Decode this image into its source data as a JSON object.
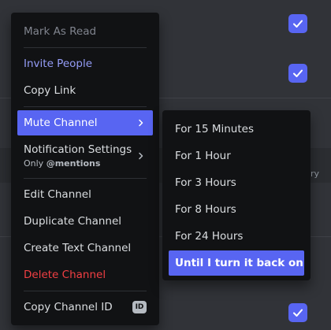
{
  "background": {
    "fragment_text": "ry",
    "accent_color": "#5865f2"
  },
  "context_menu": {
    "items": [
      {
        "label": "Mark As Read",
        "state": "disabled"
      },
      {
        "label": "Invite People",
        "state": "brand"
      },
      {
        "label": "Copy Link"
      },
      {
        "label": "Mute Channel",
        "state": "active",
        "has_submenu": true
      },
      {
        "label": "Notification Settings",
        "sublabel_prefix": "Only ",
        "sublabel_value": "@mentions",
        "has_submenu": true
      },
      {
        "label": "Edit Channel"
      },
      {
        "label": "Duplicate Channel"
      },
      {
        "label": "Create Text Channel"
      },
      {
        "label": "Delete Channel",
        "state": "danger"
      },
      {
        "label": "Copy Channel ID",
        "badge": "ID"
      }
    ]
  },
  "mute_submenu": {
    "items": [
      {
        "label": "For 15 Minutes"
      },
      {
        "label": "For 1 Hour"
      },
      {
        "label": "For 3 Hours"
      },
      {
        "label": "For 8 Hours"
      },
      {
        "label": "For 24 Hours"
      },
      {
        "label": "Until I turn it back on",
        "state": "active"
      }
    ]
  },
  "colors": {
    "brand": "#5865f2",
    "danger": "#f23f43",
    "menu_bg": "#111214"
  }
}
